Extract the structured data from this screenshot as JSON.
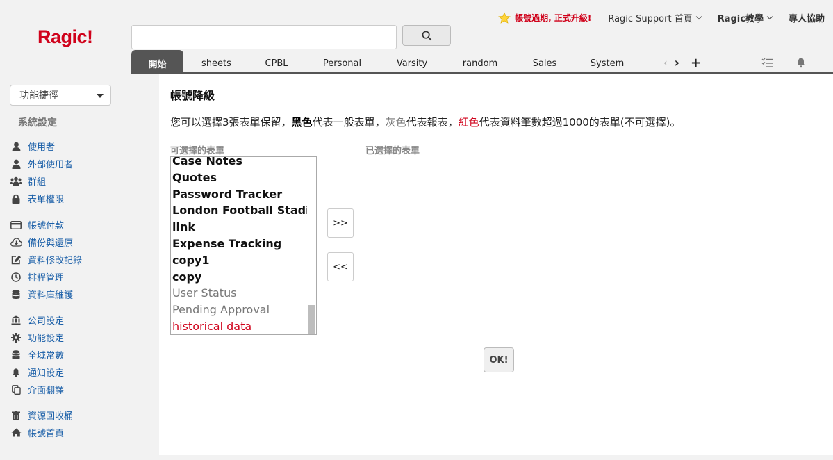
{
  "app": {
    "logo": "Ragic!"
  },
  "header": {
    "warning": "帳號過期, 正式升級!",
    "links": [
      "Ragic Support 首頁",
      "Ragic教學",
      "專人協助"
    ]
  },
  "search": {
    "placeholder": "",
    "value": ""
  },
  "tabs": [
    "開始",
    "sheets",
    "CPBL",
    "Personal",
    "Varsity",
    "random",
    "Sales",
    "System"
  ],
  "sidebar": {
    "shortcut": "功能捷徑",
    "section_title": "系統設定",
    "group1": [
      "使用者",
      "外部使用者",
      "群組",
      "表單權限"
    ],
    "group2": [
      "帳號付款",
      "備份與還原",
      "資料修改記錄",
      "排程管理",
      "資料庫維護"
    ],
    "group3": [
      "公司設定",
      "功能設定",
      "全域常數",
      "通知設定",
      "介面翻譯"
    ],
    "group4": [
      "資源回收桶",
      "帳號首頁"
    ]
  },
  "main": {
    "title": "帳號降級",
    "desc": {
      "part1": "您可以選擇3張表單保留，",
      "black": "黑色",
      "part2": "代表一般表單，",
      "gray": "灰色",
      "part3": "代表報表，",
      "red": "紅色",
      "part4": "代表資料筆數超過1000的表單(不可選擇)。"
    },
    "available_label": "可選擇的表單",
    "selected_label": "已選擇的表單",
    "available": [
      {
        "name": "Case Notes",
        "kind": "black"
      },
      {
        "name": "Quotes",
        "kind": "black"
      },
      {
        "name": "Password Tracker",
        "kind": "black"
      },
      {
        "name": "London Football Stadiur",
        "kind": "black"
      },
      {
        "name": "link",
        "kind": "black"
      },
      {
        "name": "Expense Tracking",
        "kind": "black"
      },
      {
        "name": "copy1",
        "kind": "black"
      },
      {
        "name": "copy",
        "kind": "black"
      },
      {
        "name": "User Status",
        "kind": "gray"
      },
      {
        "name": "Pending Approval",
        "kind": "gray"
      },
      {
        "name": "historical data",
        "kind": "red"
      }
    ],
    "add_button": ">>",
    "remove_button": "<<",
    "ok_button": "OK!"
  },
  "colors": {
    "brand": "#d0021b",
    "tab_active": "#555555",
    "link": "#1a5fa8"
  }
}
